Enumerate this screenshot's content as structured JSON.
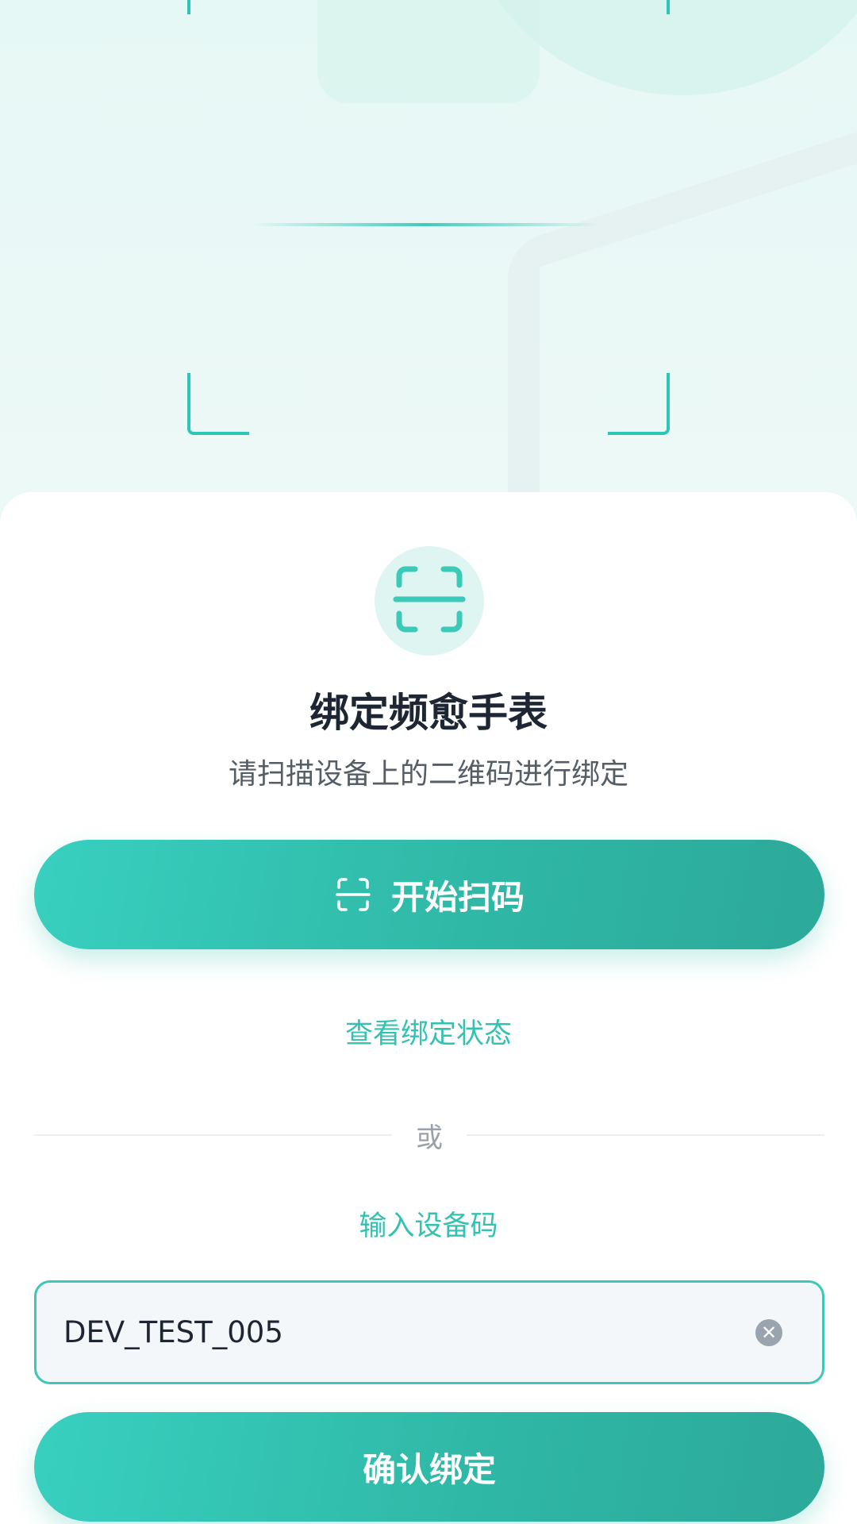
{
  "page": {
    "title": "绑定频愈手表",
    "subtitle": "请扫描设备上的二维码进行绑定"
  },
  "icons": {
    "header_icon": "scan-frame-icon",
    "scan_button_icon": "scan-frame-icon",
    "clear_icon": "clear-icon"
  },
  "actions": {
    "scan_button_label": "开始扫码",
    "view_status_link": "查看绑定状态",
    "divider_text": "或",
    "manual_input_link": "输入设备码",
    "confirm_button_label": "确认绑定"
  },
  "device_input": {
    "value": "DEV_TEST_005",
    "placeholder": ""
  },
  "colors": {
    "accent": "#33C2B1",
    "accent_dark": "#2CA99A",
    "title": "#1E2633",
    "subtitle": "#555D66"
  }
}
